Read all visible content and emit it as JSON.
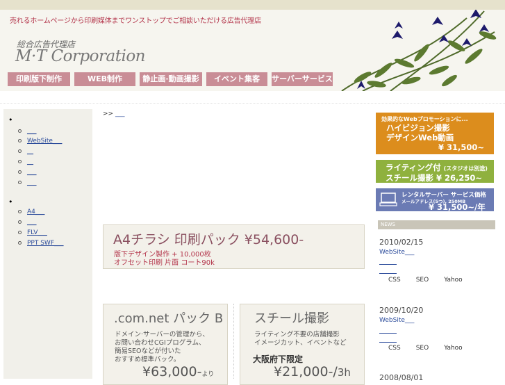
{
  "header": {
    "tagline": "売れるホームページから印刷媒体までワンストップでご相談いただける広告代理店",
    "logo_sub": "総合広告代理店",
    "logo_main": "M·T Corporation"
  },
  "nav": [
    {
      "label": "印刷版下制作",
      "width": 90
    },
    {
      "label": "WEB制作",
      "width": 88
    },
    {
      "label": "静止画·動画撮影",
      "width": 90
    },
    {
      "label": "イベント集客",
      "width": 88
    },
    {
      "label": "サーバーサービス",
      "width": 88
    }
  ],
  "sidebar": {
    "group1": [
      "___",
      "WebSite___",
      "__",
      "__",
      "___",
      "___"
    ],
    "group2": [
      "A4___",
      "___",
      "FLV___",
      "PPT SWF___"
    ]
  },
  "breadcrumb": {
    "prefix": ">>",
    "link": "___"
  },
  "banner_a4": {
    "title": "A4チラシ 印刷パック ¥54,600-",
    "line1": "版下デザイン製作 + 10,000枚",
    "line2": "オフセット印刷 片面 コート90k"
  },
  "banner_comnet": {
    "title": ".com.net パック B",
    "line1": "ドメイン·サーバーの管理から、",
    "line2": "お問い合わせCGIプログラム、",
    "line3": "簡易SEOなどが付いた",
    "line4": "おすすめ標準パック。",
    "price": "¥63,000-",
    "price_suffix": "より"
  },
  "banner_still": {
    "title": "スチール撮影",
    "line1": "ライティング不要の店舗撮影",
    "line2": "イメージカット、イベントなど",
    "region": "大阪府下限定",
    "price": "¥21,000-/",
    "price_suffix": "3h"
  },
  "promo1": {
    "small": "効果的なWebプロモーションに...",
    "line1": "ハイビジョン撮影",
    "line2": "デザインWeb動画",
    "price": "¥ 31,500~"
  },
  "promo2": {
    "line1": "ライティング付",
    "note": "(スタジオは別途)",
    "line2": "スチール撮影 ¥ 26,250~"
  },
  "promo3": {
    "line1": "レンタルサーバー サービス価格",
    "small": "メールアドレス(5つ), 250MB",
    "price": "¥ 31,500~/年"
  },
  "news": {
    "heading": "NEWS",
    "items": [
      {
        "date": "2010/02/15",
        "link": "WebSite___",
        "tags": [
          "CSS",
          "SEO",
          "Yahoo"
        ]
      },
      {
        "date": "2009/10/20",
        "link": "WebSite___",
        "tags": [
          "CSS",
          "SEO",
          "Yahoo"
        ]
      },
      {
        "date": "2008/08/01"
      }
    ]
  }
}
